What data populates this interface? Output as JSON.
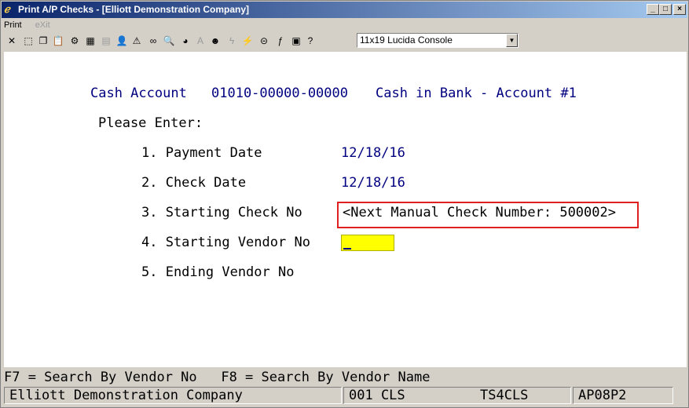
{
  "window": {
    "title": "Print A/P Checks - [Elliott Demonstration Company]"
  },
  "menu": {
    "print": "Print",
    "exit": "eXit"
  },
  "toolbar": {
    "font_select_value": "11x19 Lucida Console"
  },
  "screen": {
    "cash_account_label": "Cash Account",
    "cash_account_number": "01010-00000-00000",
    "cash_account_desc": "Cash in Bank - Account #1",
    "please_enter": "Please Enter:",
    "fields": [
      {
        "label": "1. Payment Date",
        "value": "12/18/16"
      },
      {
        "label": "2. Check Date",
        "value": "12/18/16"
      },
      {
        "label": "3. Starting Check No",
        "value": "<Next Manual Check Number: 500002>"
      },
      {
        "label": "4. Starting Vendor No",
        "value": ""
      },
      {
        "label": "5. Ending Vendor No",
        "value": ""
      }
    ]
  },
  "function_keys": "F7 = Search By Vendor No   F8 = Search By Vendor Name",
  "status": {
    "company": "Elliott Demonstration Company",
    "user": "001 CLS",
    "station": "TS4CLS",
    "program": "AP08P2"
  }
}
